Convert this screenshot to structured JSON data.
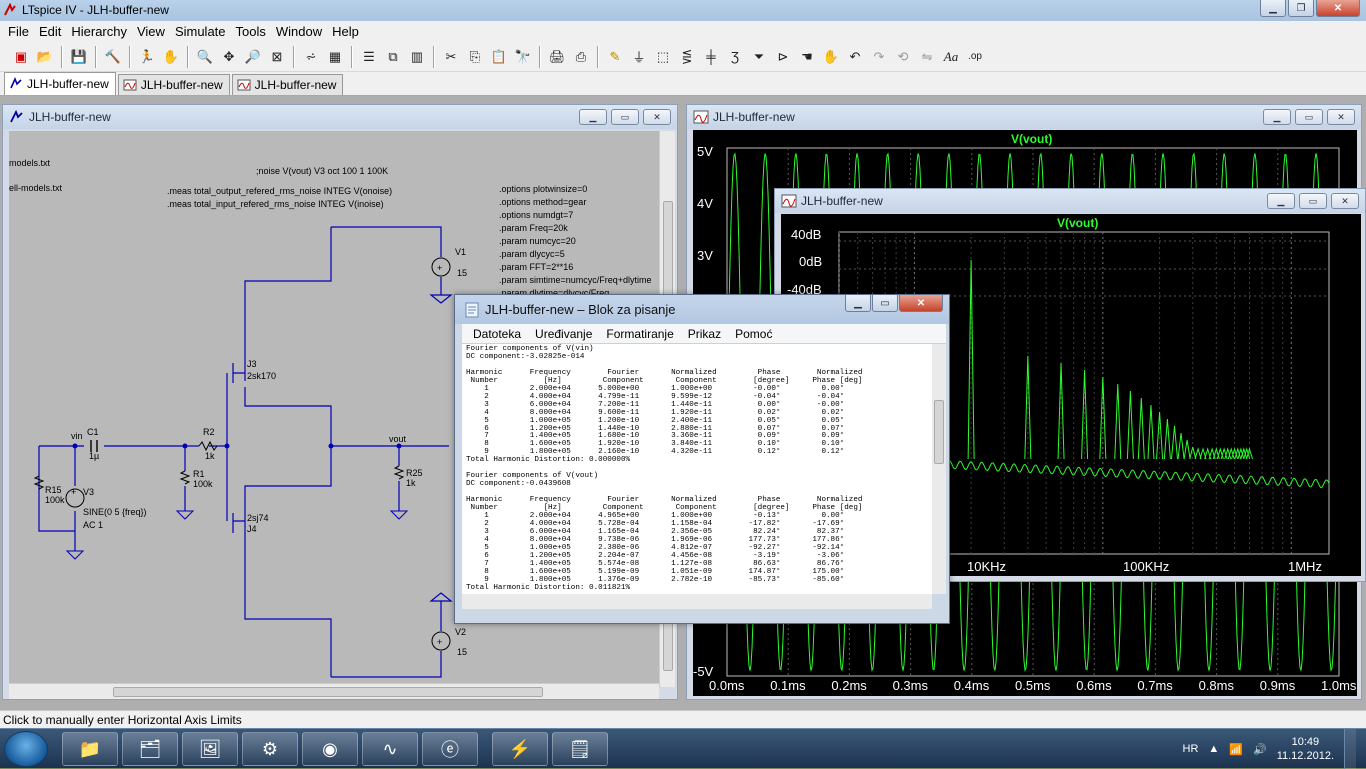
{
  "app": {
    "title": "LTspice IV - JLH-buffer-new"
  },
  "menu": [
    "File",
    "Edit",
    "Hierarchy",
    "View",
    "Simulate",
    "Tools",
    "Window",
    "Help"
  ],
  "tabs": [
    {
      "label": "JLH-buffer-new",
      "kind": "schematic-icon"
    },
    {
      "label": "JLH-buffer-new",
      "kind": "waveform-icon"
    },
    {
      "label": "JLH-buffer-new",
      "kind": "waveform-icon"
    }
  ],
  "schematic": {
    "title": "JLH-buffer-new",
    "directives_left": [
      "models.txt",
      "ell-models.txt"
    ],
    "noise_cmd": ";noise V(vout) V3 oct 100 1 100K",
    "meas": [
      ".meas total_output_refered_rms_noise INTEG V(onoise)",
      ".meas total_input_refered_rms_noise INTEG V(inoise)"
    ],
    "options": [
      ".options plotwinsize=0",
      ".options method=gear",
      ".options numdgt=7",
      ".param Freq=20k",
      ".param numcyc=20",
      ".param dlycyc=5",
      ".param FFT=2**16",
      ".param simtime=numcyc/Freq+dlytime",
      ".param dlytime=dlycyc/Freq"
    ],
    "labels": {
      "v1": "V1",
      "v1val": "15",
      "v2": "V2",
      "v2val": "15",
      "j3": "J3",
      "j3part": "2sk170",
      "j4": "J4",
      "j4part": "2sj74",
      "r2": "R2",
      "r2val": "1k",
      "r1": "R1",
      "r1val": "100k",
      "c1": "C1",
      "c1val": "1µ",
      "r15": "R15",
      "r15val": "100k",
      "v3": "V3",
      "v3val": "SINE(0 5 {freq})",
      "v3ac": "AC 1",
      "r25": "R25",
      "r25val": "1k",
      "vin": "vin",
      "vout": "vout"
    }
  },
  "plot_time": {
    "title": "JLH-buffer-new",
    "trace": "V(vout)",
    "y_ticks": [
      "5V",
      "4V",
      "3V",
      "-5V"
    ],
    "x_ticks": [
      "0.0ms",
      "0.1ms",
      "0.2ms",
      "0.3ms",
      "0.4ms",
      "0.5ms",
      "0.6ms",
      "0.7ms",
      "0.8ms",
      "0.9ms",
      "1.0ms"
    ],
    "trace_color": "#2dfc2d"
  },
  "plot_fft": {
    "title": "JLH-buffer-new",
    "trace": "V(vout)",
    "y_ticks": [
      "40dB",
      "0dB",
      "-40dB"
    ],
    "x_ticks": [
      "10KHz",
      "100KHz",
      "1MHz"
    ]
  },
  "notepad": {
    "title": "JLH-buffer-new – Blok za pisanje",
    "menu": [
      "Datoteka",
      "Uređivanje",
      "Formatiranje",
      "Prikaz",
      "Pomoć"
    ],
    "content": "Fourier components of V(vin)\nDC component:-3.02825e-014\n\nHarmonic      Frequency        Fourier       Normalized         Phase        Normalized\n Number          [Hz]         Component       Component        [degree]     Phase [deg]\n    1         2.000e+04      5.000e+00       1.000e+00         -0.00°         0.00°\n    2         4.000e+04      4.799e-11       9.599e-12         -0.04°        -0.04°\n    3         6.000e+04      7.200e-11       1.440e-11          0.00°        -0.00°\n    4         8.000e+04      9.600e-11       1.920e-11          0.02°         0.02°\n    5         1.000e+05      1.200e-10       2.400e-11          0.05°         0.05°\n    6         1.200e+05      1.440e-10       2.880e-11          0.07°         0.07°\n    7         1.400e+05      1.680e-10       3.360e-11          0.09°         0.09°\n    8         1.600e+05      1.920e-10       3.840e-11          0.10°         0.10°\n    9         1.800e+05      2.160e-10       4.320e-11          0.12°         0.12°\nTotal Harmonic Distortion: 0.000000%\n\nFourier components of V(vout)\nDC component:-0.0439608\n\nHarmonic      Frequency        Fourier       Normalized         Phase        Normalized\n Number          [Hz]         Component       Component        [degree]     Phase [deg]\n    1         2.000e+04      4.965e+00       1.000e+00         -0.13°         0.00°\n    2         4.000e+04      5.728e-04       1.158e-04        -17.82°       -17.69°\n    3         6.000e+04      1.165e-04       2.356e-05         82.24°        82.37°\n    4         8.000e+04      9.738e-06       1.969e-06        177.73°       177.86°\n    5         1.000e+05      2.380e-06       4.812e-07        -92.27°       -92.14°\n    6         1.200e+05      2.204e-07       4.456e-08         -3.19°        -3.06°\n    7         1.400e+05      5.574e-08       1.127e-08         86.63°        86.76°\n    8         1.600e+05      5.199e-09       1.051e-09        174.87°       175.00°\n    9         1.800e+05      1.376e-09       2.782e-10        -85.73°       -85.60°\nTotal Harmonic Distortion: 0.011821%"
  },
  "status": "Click to manually enter Horizontal Axis Limits",
  "taskbar": {
    "lang": "HR",
    "time": "10:49",
    "date": "11.12.2012."
  }
}
